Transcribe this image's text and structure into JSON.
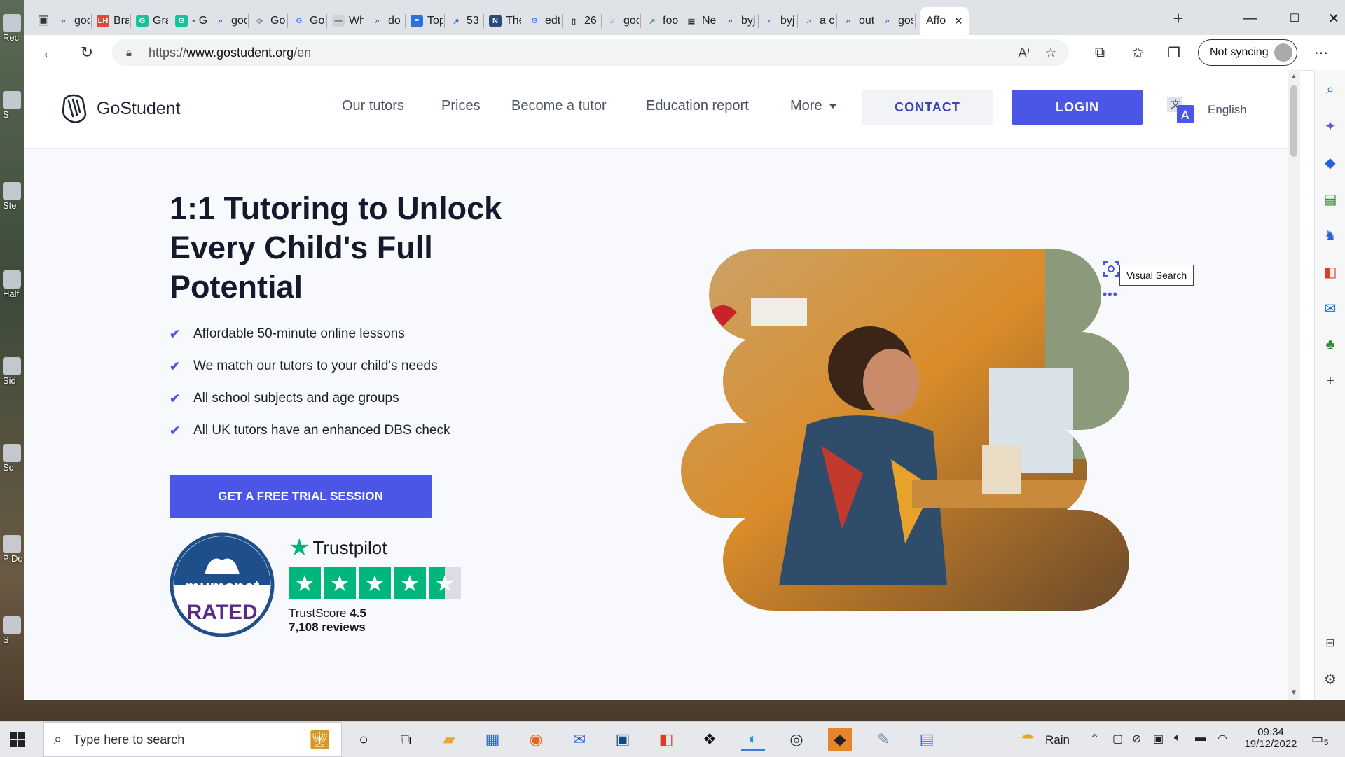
{
  "desktop": {
    "icons": [
      {
        "label": "Rec"
      },
      {
        "label": "S"
      },
      {
        "label": "Ste"
      },
      {
        "label": "Half"
      },
      {
        "label": "Sid"
      },
      {
        "label": "Sc"
      },
      {
        "label": "P Do"
      },
      {
        "label": "S"
      }
    ]
  },
  "browser": {
    "tabs": [
      {
        "label": "goo",
        "icon": "search-icon"
      },
      {
        "label": "Bra",
        "icon": "lh-icon"
      },
      {
        "label": "Gra",
        "icon": "grammarly-icon"
      },
      {
        "label": "- G",
        "icon": "grammarly-icon"
      },
      {
        "label": "goo",
        "icon": "search-icon"
      },
      {
        "label": "Go",
        "icon": "loading-icon"
      },
      {
        "label": "Go",
        "icon": "google-icon"
      },
      {
        "label": "Wh",
        "icon": "page-icon"
      },
      {
        "label": "do",
        "icon": "search-icon"
      },
      {
        "label": "Top",
        "icon": "docs-icon"
      },
      {
        "label": "53",
        "icon": "trend-icon"
      },
      {
        "label": "The",
        "icon": "news-icon"
      },
      {
        "label": "edt",
        "icon": "google-icon"
      },
      {
        "label": "26",
        "icon": "file-icon"
      },
      {
        "label": "goo",
        "icon": "search-icon"
      },
      {
        "label": "foo",
        "icon": "chart-icon"
      },
      {
        "label": "Ne",
        "icon": "mail-icon"
      },
      {
        "label": "byj",
        "icon": "search-icon"
      },
      {
        "label": "byj",
        "icon": "search-icon"
      },
      {
        "label": "a c",
        "icon": "search-icon"
      },
      {
        "label": "out",
        "icon": "search-icon"
      },
      {
        "label": "gos",
        "icon": "search-icon"
      },
      {
        "label": "Affo",
        "icon": "none",
        "active": true
      }
    ],
    "url_prefix": "https://",
    "url_domain": "www.gostudent.org",
    "url_path": "/en",
    "sync_label": "Not syncing"
  },
  "site": {
    "brand": "GoStudent",
    "nav": [
      {
        "label": "Our tutors"
      },
      {
        "label": "Prices"
      },
      {
        "label": "Become a tutor"
      },
      {
        "label": "Education report"
      },
      {
        "label": "More"
      }
    ],
    "contact_label": "CONTACT",
    "login_label": "LOGIN",
    "language_label": "English",
    "hero": {
      "title": "1:1 Tutoring to Unlock Every Child's Full Potential",
      "bullets": [
        "Affordable 50-minute online lessons",
        "We match our tutors to your child's needs",
        "All school subjects and age groups",
        "All UK tutors have an enhanced DBS check"
      ],
      "cta_label": "GET A FREE TRIAL SESSION"
    },
    "mumsnet": {
      "name": "mumsnet",
      "rated": "RATED"
    },
    "trustpilot": {
      "brand": "Trustpilot",
      "score_label": "TrustScore",
      "score": "4.5",
      "reviews": "7,108 reviews",
      "rating": 4.5
    },
    "visual_search_tooltip": "Visual Search",
    "visual_search_more": "•••"
  },
  "taskbar": {
    "search_placeholder": "Type here to search",
    "weather": "Rain",
    "time": "09:34",
    "date": "19/12/2022",
    "notification_count": "5"
  },
  "colors": {
    "brand_blue": "#4b55e6",
    "trustpilot_green": "#00b67a",
    "mumsnet_navy": "#1f4f8a",
    "mumsnet_purple": "#5b2a86"
  }
}
